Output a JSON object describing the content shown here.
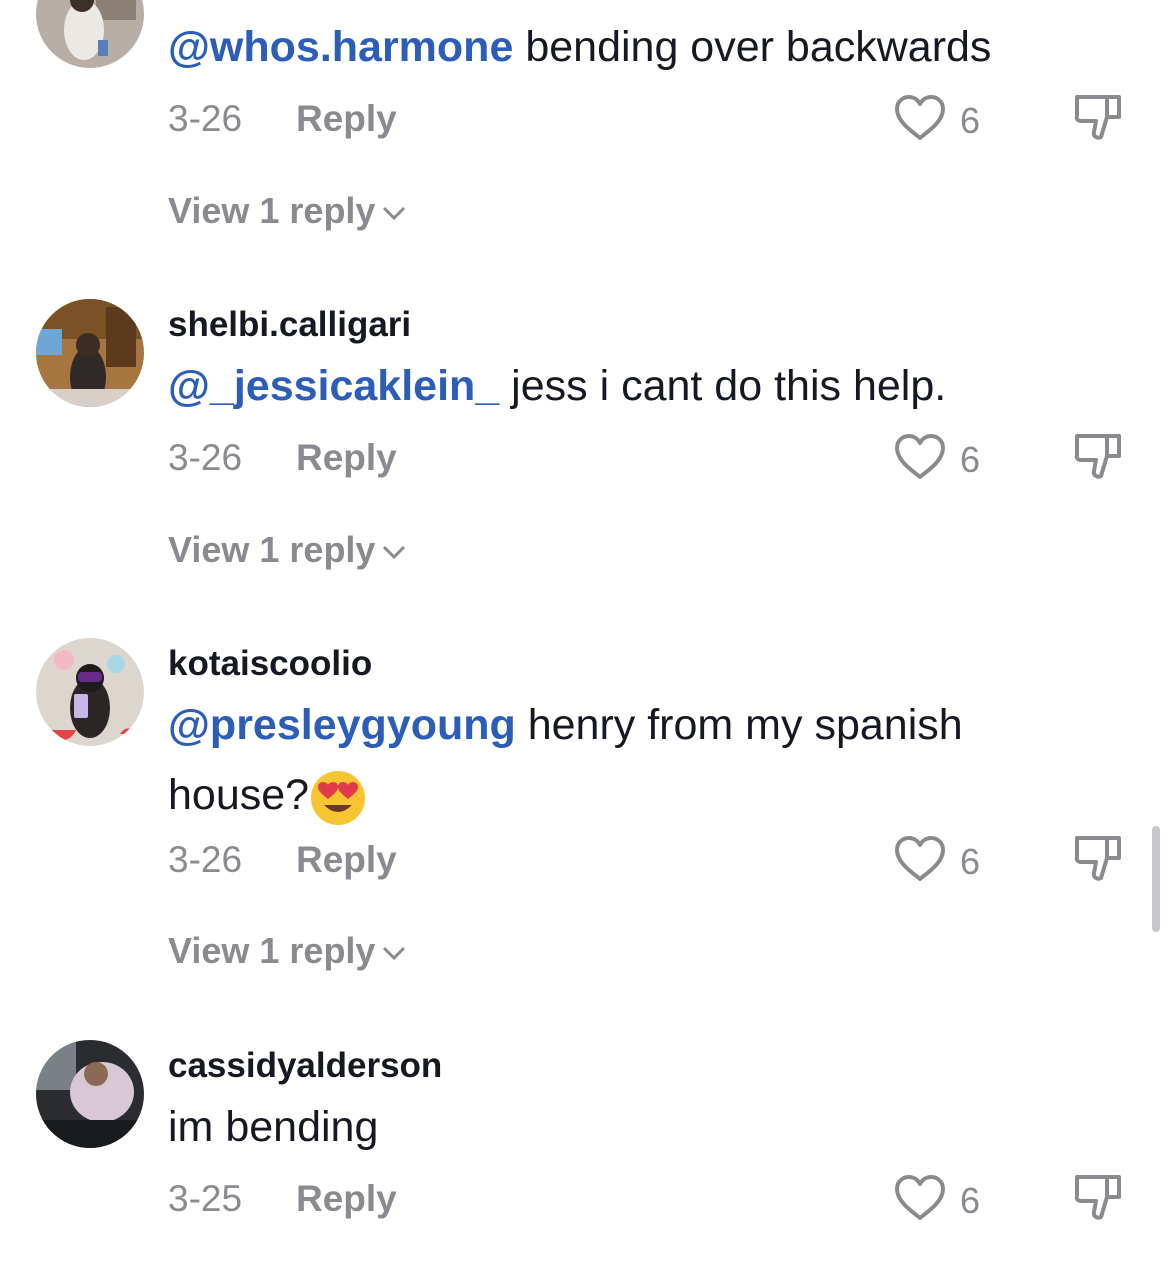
{
  "comments": [
    {
      "username": "",
      "mention": "@whos.harmone",
      "text": " bending over backwards",
      "date": "3-26",
      "reply_label": "Reply",
      "likes": "6",
      "view_replies": "View 1 reply"
    },
    {
      "username": "shelbi.calligari",
      "mention": "@_jessicaklein_",
      "text": " jess i cant do this help.",
      "date": "3-26",
      "reply_label": "Reply",
      "likes": "6",
      "view_replies": "View 1 reply"
    },
    {
      "username": "kotaiscoolio",
      "mention": "@presleygyoung",
      "text": " henry from my spanish house?",
      "emoji": "heart-eyes-emoji",
      "date": "3-26",
      "reply_label": "Reply",
      "likes": "6",
      "view_replies": "View 1 reply"
    },
    {
      "username": "cassidyalderson",
      "mention": "",
      "text": "im bending",
      "date": "3-25",
      "reply_label": "Reply",
      "likes": "6"
    }
  ],
  "colors": {
    "mention": "#2b5db9",
    "secondary_text": "#8a8b91",
    "primary_text": "#161823"
  }
}
